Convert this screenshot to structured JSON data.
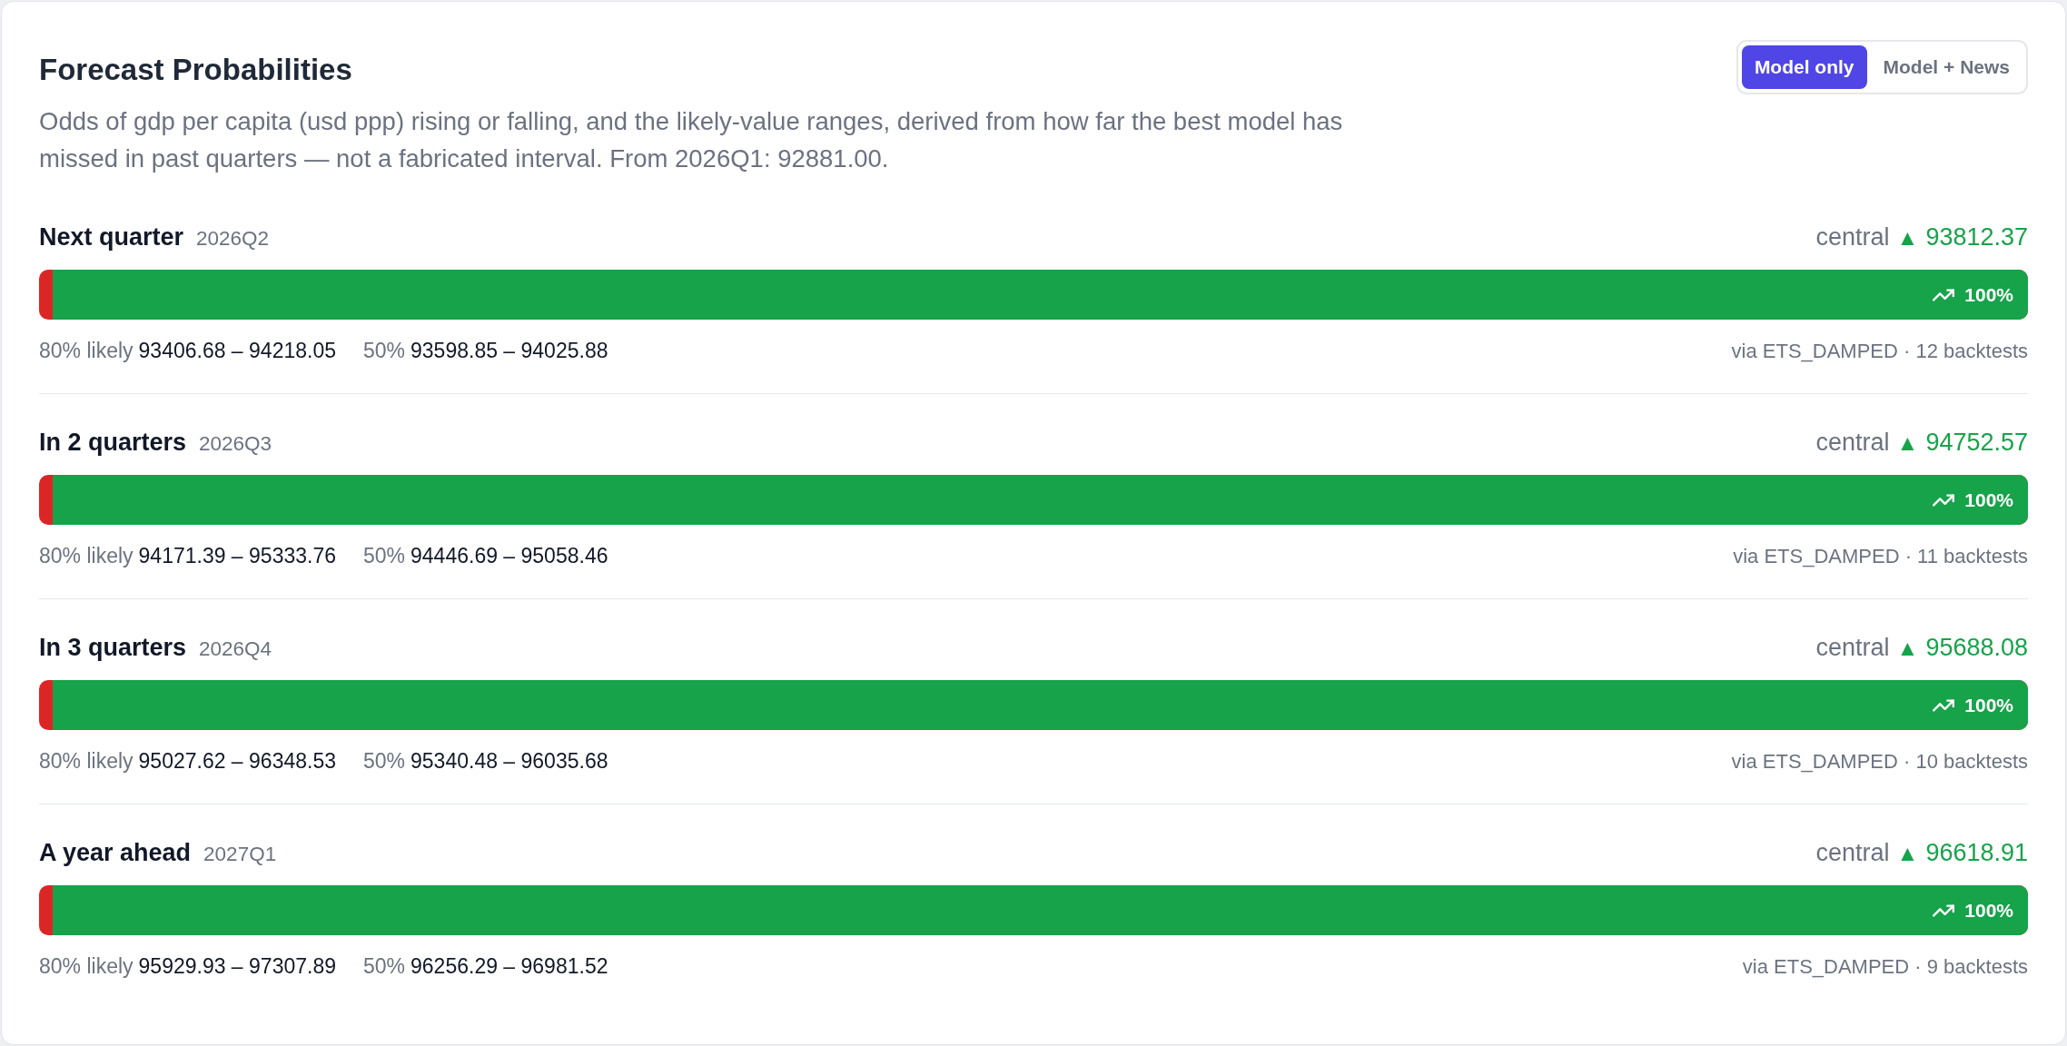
{
  "title": "Forecast Probabilities",
  "description": "Odds of gdp per capita (usd ppp) rising or falling, and the likely-value ranges, derived from how far the best model has missed in past quarters — not a fabricated interval. From 2026Q1: 92881.00.",
  "view_toggle": [
    {
      "label": "Model only",
      "selected": true
    },
    {
      "label": "Model + News",
      "selected": false
    }
  ],
  "horizons": [
    {
      "label": "Next quarter",
      "period": "2026Q2",
      "central_label": "central",
      "arrow": "▲",
      "central_value": "93812.37",
      "level": 0.993,
      "probability": "100%",
      "range_80_label": "80% likely",
      "range_80": "93406.68 – 94218.05",
      "range_50_label": "50%",
      "range_50": "93598.85 – 94025.88",
      "source": "via ETS_DAMPED · 12 backtests"
    },
    {
      "label": "In 2 quarters",
      "period": "2026Q3",
      "central_label": "central",
      "arrow": "▲",
      "central_value": "94752.57",
      "level": 0.993,
      "probability": "100%",
      "range_80_label": "80% likely",
      "range_80": "94171.39 – 95333.76",
      "range_50_label": "50%",
      "range_50": "94446.69 – 95058.46",
      "source": "via ETS_DAMPED · 11 backtests"
    },
    {
      "label": "In 3 quarters",
      "period": "2026Q4",
      "central_label": "central",
      "arrow": "▲",
      "central_value": "95688.08",
      "level": 0.993,
      "probability": "100%",
      "range_80_label": "80% likely",
      "range_80": "95027.62 – 96348.53",
      "range_50_label": "50%",
      "range_50": "95340.48 – 96035.68",
      "source": "via ETS_DAMPED · 10 backtests"
    },
    {
      "label": "A year ahead",
      "period": "2027Q1",
      "central_label": "central",
      "arrow": "▲",
      "central_value": "96618.91",
      "level": 0.993,
      "probability": "100%",
      "range_80_label": "80% likely",
      "range_80": "95929.93 – 97307.89",
      "range_50_label": "50%",
      "range_50": "96256.29 – 96981.52",
      "source": "via ETS_DAMPED · 9 backtests"
    }
  ]
}
